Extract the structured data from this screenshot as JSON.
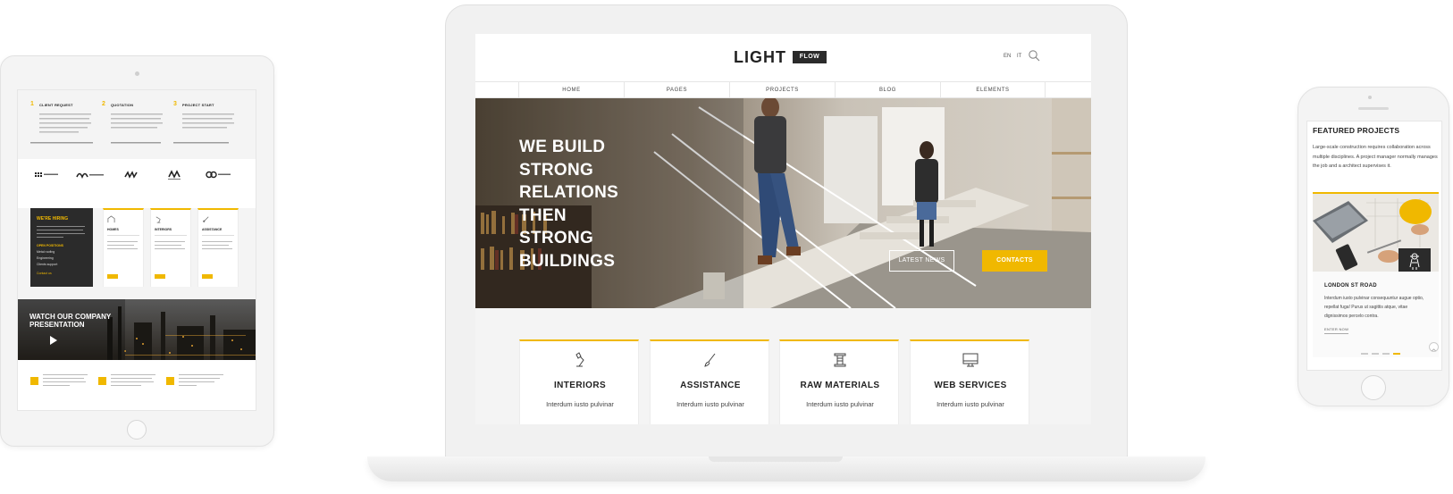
{
  "colors": {
    "accent": "#f0b800",
    "dark": "#2b2b2b"
  },
  "laptop": {
    "logo": {
      "word": "LIGHT",
      "tag": "FLOW"
    },
    "languages": [
      "EN",
      "IT"
    ],
    "nav": [
      "HOME",
      "PAGES",
      "PROJECTS",
      "BLOG",
      "ELEMENTS"
    ],
    "hero": {
      "title_lines": [
        "WE BUILD",
        "STRONG",
        "RELATIONS",
        "THEN",
        "STRONG",
        "BUILDINGS"
      ],
      "btn_news": "LATEST NEWS",
      "btn_contacts": "CONTACTS"
    },
    "services": [
      {
        "icon": "lamp-icon",
        "title": "INTERIORS",
        "text": "Interdum iusto pulvinar"
      },
      {
        "icon": "brush-icon",
        "title": "ASSISTANCE",
        "text": "Interdum iusto pulvinar"
      },
      {
        "icon": "spool-icon",
        "title": "RAW MATERIALS",
        "text": "Interdum iusto pulvinar"
      },
      {
        "icon": "monitor-icon",
        "title": "WEB SERVICES",
        "text": "Interdum iusto pulvinar"
      }
    ]
  },
  "tablet": {
    "steps": [
      {
        "num": "1",
        "title": "CLIENT REQUEST"
      },
      {
        "num": "2",
        "title": "QUOTATION"
      },
      {
        "num": "3",
        "title": "PROJECT START"
      }
    ],
    "hiring": {
      "title": "WE'RE HIRING",
      "label": "OPEN POSITIONS",
      "items": [
        "Metal roofing",
        "Engineering",
        "Clients support"
      ],
      "link": "Contact us"
    },
    "cards": [
      "HOMES",
      "INTERIORS",
      "ASSISTANCE"
    ],
    "video_title": "WATCH OUR COMPANY PRESENTATION"
  },
  "phone": {
    "title": "FEATURED PROJECTS",
    "text": "Large-scale construction requires collaboration across multiple disciplines. A project manager normally manages the job and a architect supervises it.",
    "card_title": "LONDON ST ROAD",
    "card_text": "Interdum iusto pulvinar consequuntur augue optio, repellat fuga! Purus ut sagittis atque, vitae dignissimos percelo contra.",
    "enter": "ENTER NOW"
  }
}
